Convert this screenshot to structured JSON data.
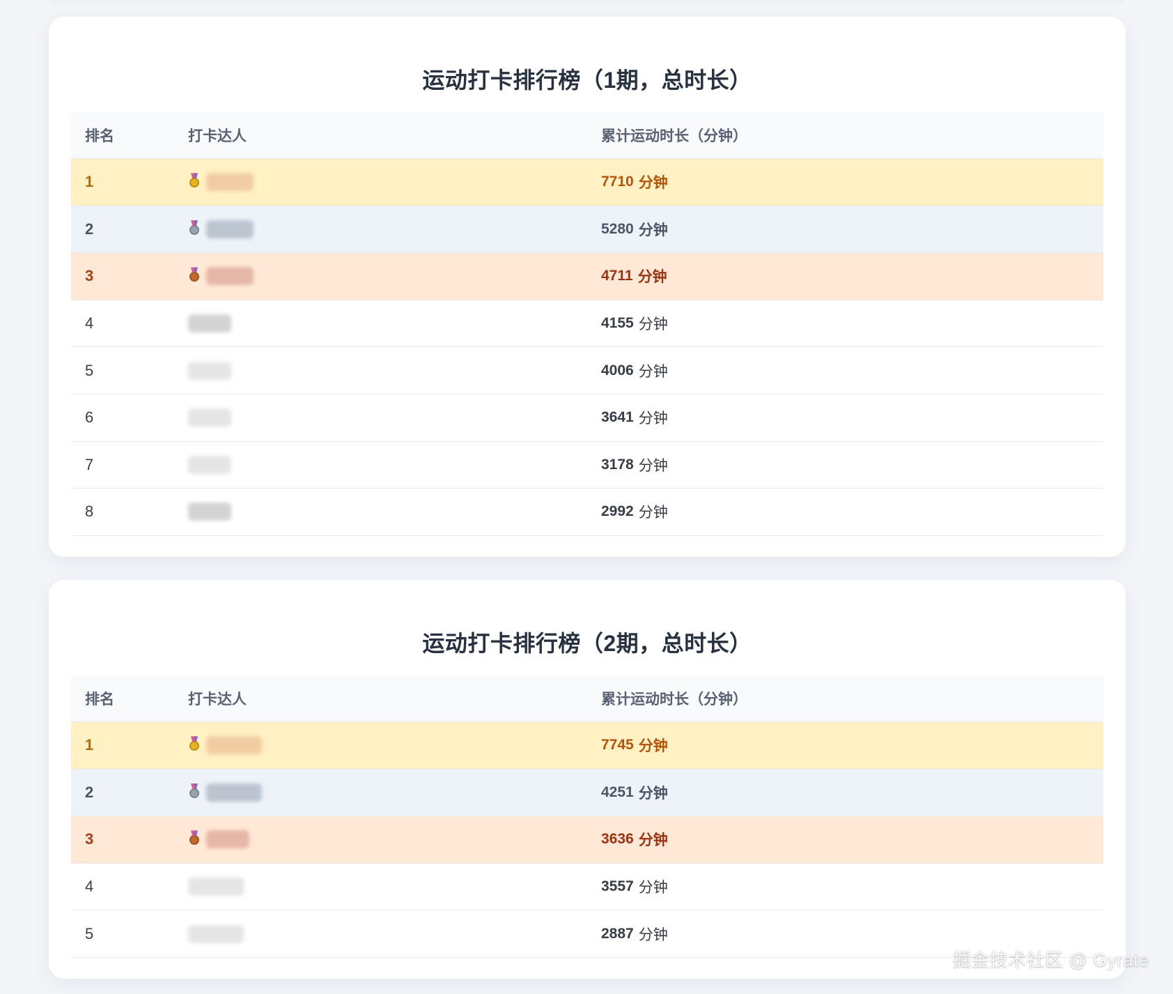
{
  "boards": [
    {
      "title": "运动打卡排行榜（1期，总时长）",
      "headers": {
        "rank": "排名",
        "name": "打卡达人",
        "time": "累计运动时长（分钟）"
      },
      "rows": [
        {
          "rank": "1",
          "value": "7710",
          "unit": "分钟",
          "medal": "gold"
        },
        {
          "rank": "2",
          "value": "5280",
          "unit": "分钟",
          "medal": "silver"
        },
        {
          "rank": "3",
          "value": "4711",
          "unit": "分钟",
          "medal": "bronze"
        },
        {
          "rank": "4",
          "value": "4155",
          "unit": "分钟",
          "medal": ""
        },
        {
          "rank": "5",
          "value": "4006",
          "unit": "分钟",
          "medal": ""
        },
        {
          "rank": "6",
          "value": "3641",
          "unit": "分钟",
          "medal": ""
        },
        {
          "rank": "7",
          "value": "3178",
          "unit": "分钟",
          "medal": ""
        },
        {
          "rank": "8",
          "value": "2992",
          "unit": "分钟",
          "medal": ""
        }
      ]
    },
    {
      "title": "运动打卡排行榜（2期，总时长）",
      "headers": {
        "rank": "排名",
        "name": "打卡达人",
        "time": "累计运动时长（分钟）"
      },
      "rows": [
        {
          "rank": "1",
          "value": "7745",
          "unit": "分钟",
          "medal": "gold"
        },
        {
          "rank": "2",
          "value": "4251",
          "unit": "分钟",
          "medal": "silver"
        },
        {
          "rank": "3",
          "value": "3636",
          "unit": "分钟",
          "medal": "bronze"
        },
        {
          "rank": "4",
          "value": "3557",
          "unit": "分钟",
          "medal": ""
        },
        {
          "rank": "5",
          "value": "2887",
          "unit": "分钟",
          "medal": ""
        }
      ]
    }
  ],
  "watermark": "掘金技术社区 @ Gyrate",
  "colors": {
    "page_background": "#f3f5f9",
    "gold_row": "#fff1c3",
    "silver_row": "#eef3f9",
    "bronze_row": "#ffe9d6",
    "gold_text": "#b45309",
    "silver_text": "#4b5565",
    "bronze_text": "#9a3412"
  },
  "icons": {
    "gold_medal": "gold-medal-icon",
    "silver_medal": "silver-medal-icon",
    "bronze_medal": "bronze-medal-icon"
  }
}
